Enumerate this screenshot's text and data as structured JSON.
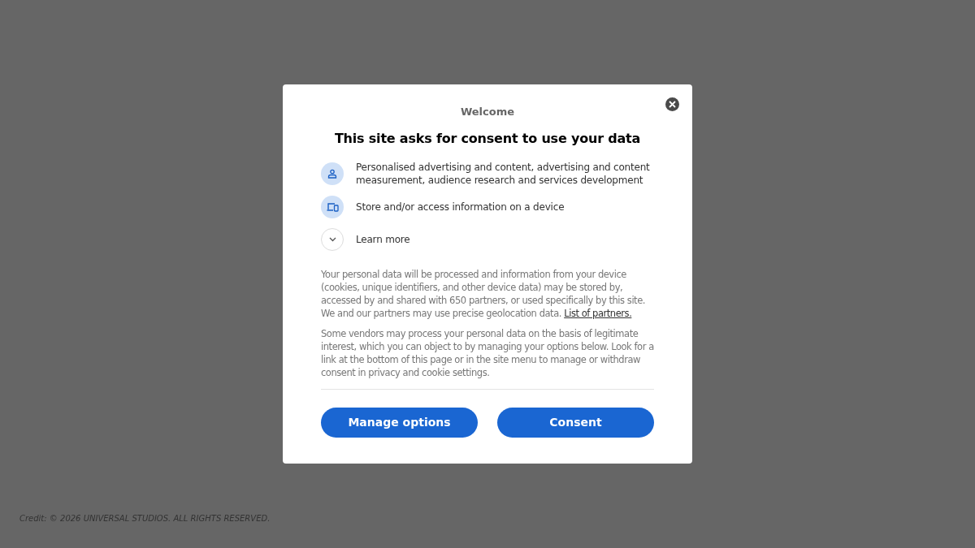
{
  "dialog": {
    "subtitle": "Welcome",
    "title": "This site asks for consent to use your data",
    "purposes": [
      {
        "kind": "person",
        "label": "Personalised advertising and content, advertising and content measurement, audience research and services development"
      },
      {
        "kind": "device",
        "label": "Store and/or access information on a device"
      },
      {
        "kind": "expand",
        "label": "Learn more"
      }
    ],
    "paragraphs": [
      {
        "text": "Your personal data will be processed and information from your device (cookies, unique identifiers, and other device data) may be stored by, accessed by and shared with 650 partners, or used specifically by this site. We and our partners may use precise geolocation data.",
        "link": "List of partners."
      },
      {
        "text": "Some vendors may process your personal data on the basis of legitimate interest, which you can object to by managing your options below. Look for a link at the bottom of this page or in the site menu to manage or withdraw consent in privacy and cookie settings."
      }
    ],
    "buttons": [
      "Manage options",
      "Consent"
    ]
  },
  "credit": "Credit: © 2026 UNIVERSAL STUDIOS. ALL RIGHTS RESERVED."
}
